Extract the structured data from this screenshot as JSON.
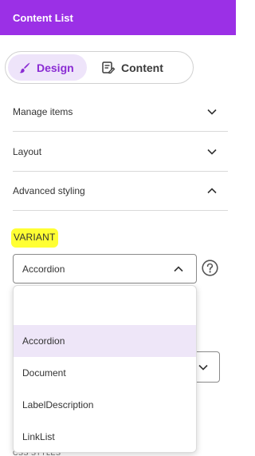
{
  "header": {
    "title": "Content List"
  },
  "toggle": {
    "design_label": "Design",
    "content_label": "Content"
  },
  "sections": [
    {
      "label": "Manage items",
      "state": "collapsed"
    },
    {
      "label": "Layout",
      "state": "collapsed"
    },
    {
      "label": "Advanced styling",
      "state": "expanded"
    }
  ],
  "variant": {
    "label": "VARIANT",
    "selected": "Accordion",
    "options": [
      "",
      "Accordion",
      "Document",
      "LabelDescription",
      "LinkList"
    ]
  },
  "partial_label": "CSS STYLES",
  "colors": {
    "accent": "#9B30E6",
    "highlight": "#FFFF33",
    "selected_option": "#EEE6F8"
  }
}
